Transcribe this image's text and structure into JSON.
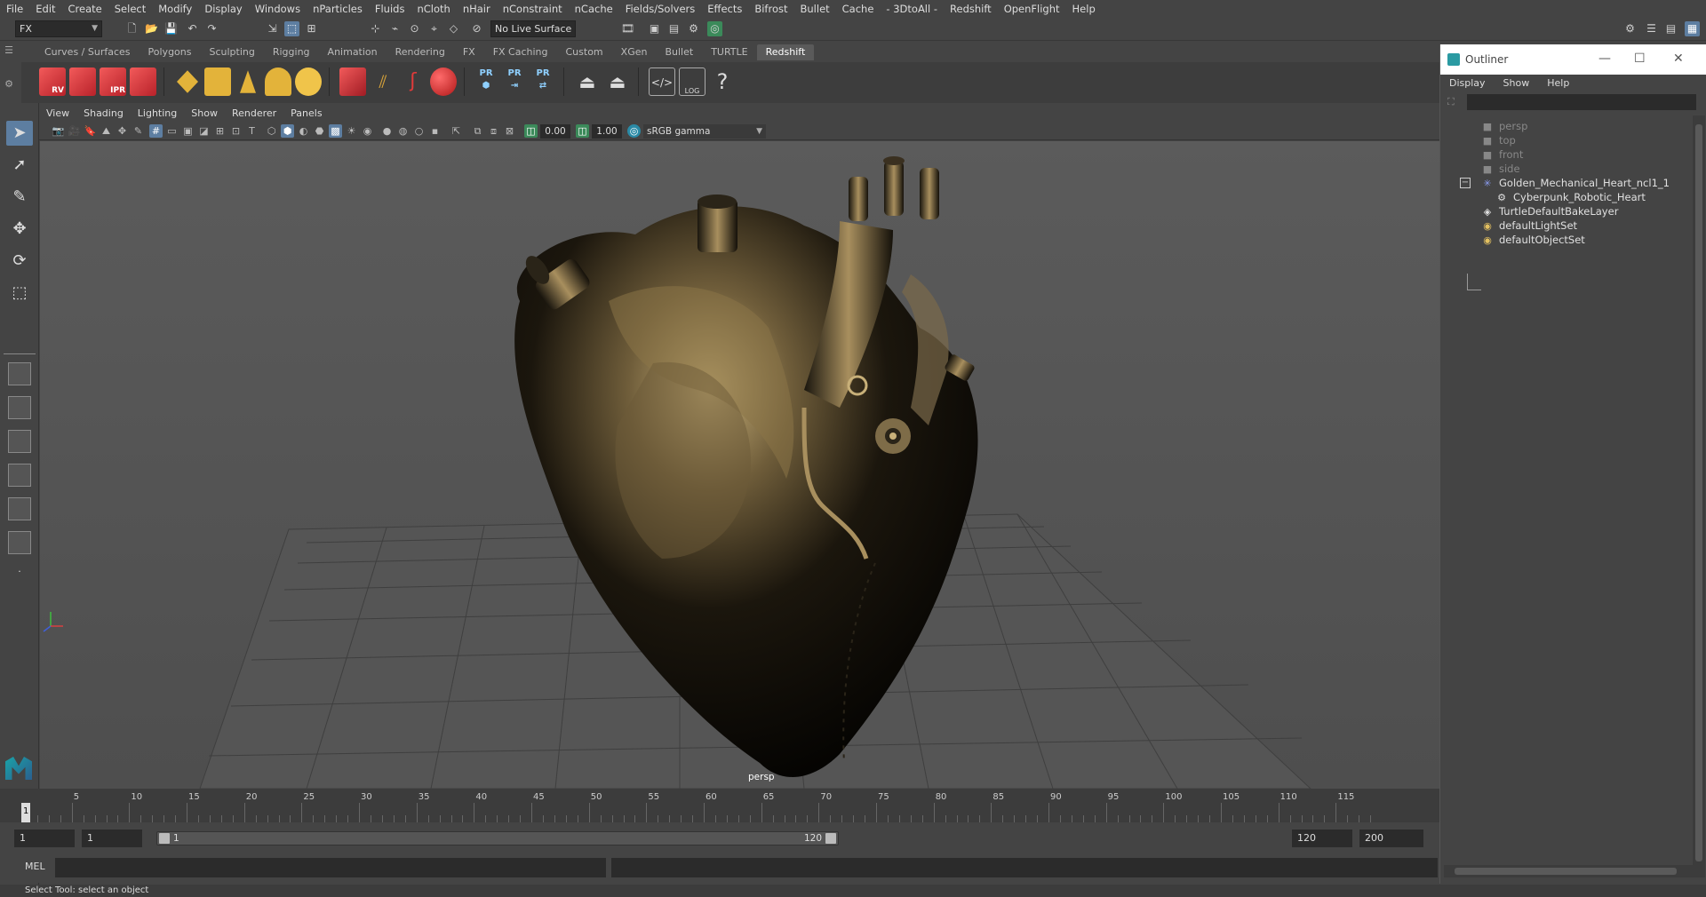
{
  "menubar": [
    "File",
    "Edit",
    "Create",
    "Select",
    "Modify",
    "Display",
    "Windows",
    "nParticles",
    "Fluids",
    "nCloth",
    "nHair",
    "nConstraint",
    "nCache",
    "Fields/Solvers",
    "Effects",
    "Bifrost",
    "Bullet",
    "Cache",
    "- 3DtoAll -",
    "Redshift",
    "OpenFlight",
    "Help"
  ],
  "status": {
    "mode": "FX",
    "live_surface": "No Live Surface"
  },
  "shelf": {
    "tabs": [
      "Curves / Surfaces",
      "Polygons",
      "Sculpting",
      "Rigging",
      "Animation",
      "Rendering",
      "FX",
      "FX Caching",
      "Custom",
      "XGen",
      "Bullet",
      "TURTLE",
      "Redshift"
    ],
    "active_tab": "Redshift",
    "icon_labels": {
      "rv": "RV",
      "ipr": "IPR",
      "pr1": "PR",
      "pr2": "PR",
      "pr3": "PR",
      "log": "LOG"
    }
  },
  "panel": {
    "menu": [
      "View",
      "Shading",
      "Lighting",
      "Show",
      "Renderer",
      "Panels"
    ],
    "exposure": "0.00",
    "gamma_value": "1.00",
    "color_space": "sRGB gamma",
    "camera_label": "persp"
  },
  "timeline": {
    "ticks": [
      1,
      5,
      10,
      15,
      20,
      25,
      30,
      35,
      40,
      45,
      50,
      55,
      60,
      65,
      70,
      75,
      80,
      85,
      90,
      95,
      100,
      105,
      110,
      115
    ],
    "current_frame": "1",
    "start": "1",
    "playback_start": "1",
    "range_start_label": "1",
    "range_end_label": "120",
    "playback_end": "120",
    "end": "200"
  },
  "command": {
    "label": "MEL"
  },
  "help_line": "Select Tool: select an object",
  "outliner": {
    "title": "Outliner",
    "menu": [
      "Display",
      "Show",
      "Help"
    ],
    "items": [
      {
        "label": "persp",
        "icon": "camera-icon",
        "dim": true
      },
      {
        "label": "top",
        "icon": "camera-icon",
        "dim": true
      },
      {
        "label": "front",
        "icon": "camera-icon",
        "dim": true
      },
      {
        "label": "side",
        "icon": "camera-icon",
        "dim": true
      },
      {
        "label": "Golden_Mechanical_Heart_ncl1_1",
        "icon": "asterisk-icon",
        "dim": false
      },
      {
        "label": "Cyberpunk_Robotic_Heart",
        "icon": "mesh-icon",
        "dim": false
      },
      {
        "label": "TurtleDefaultBakeLayer",
        "icon": "layer-icon",
        "dim": false
      },
      {
        "label": "defaultLightSet",
        "icon": "set-icon",
        "dim": false
      },
      {
        "label": "defaultObjectSet",
        "icon": "set-icon",
        "dim": false
      }
    ]
  },
  "colors": {
    "accent": "#5d7ea1",
    "redshift_red": "#d9323a",
    "gold": "#e3b33a",
    "heart_gold": "#c8b079"
  }
}
